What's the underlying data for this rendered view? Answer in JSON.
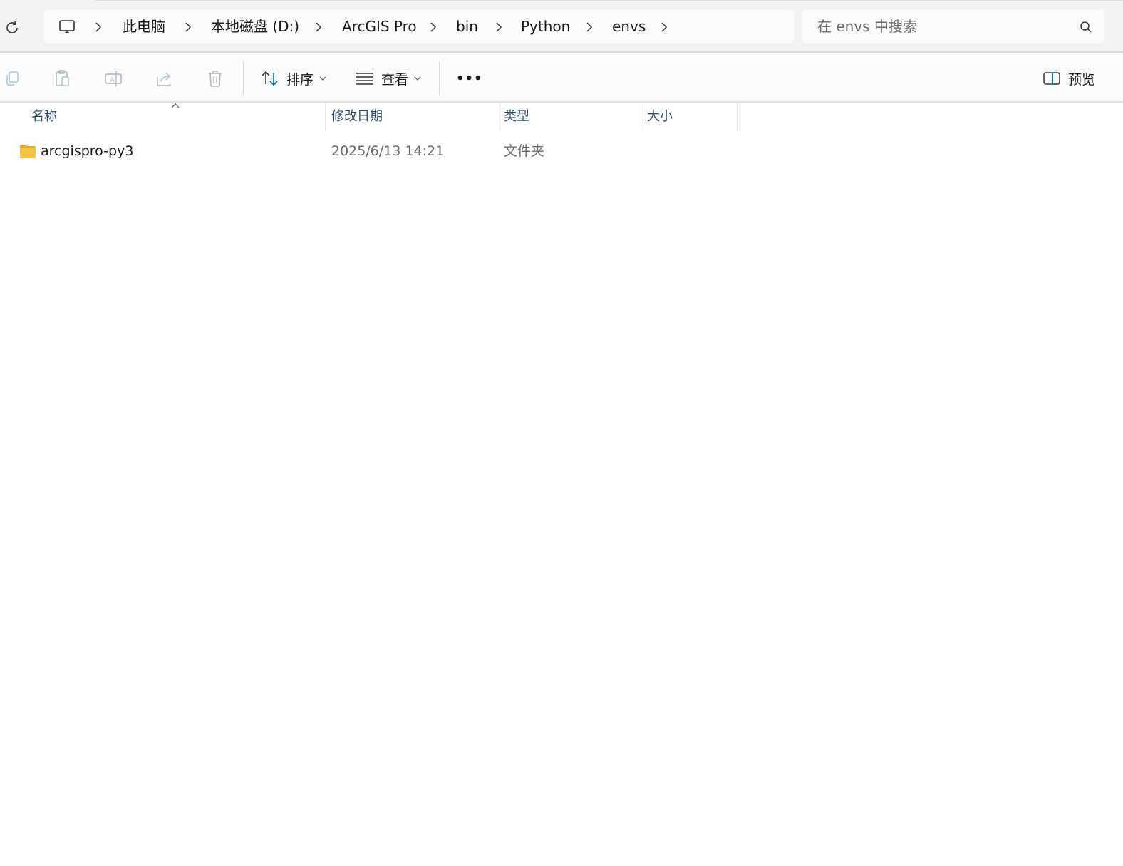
{
  "address_bar": {
    "breadcrumbs": [
      {
        "icon": "computer-icon"
      },
      {
        "label": "此电脑"
      },
      {
        "label": "本地磁盘 (D:)"
      },
      {
        "label": "ArcGIS Pro"
      },
      {
        "label": "bin"
      },
      {
        "label": "Python"
      },
      {
        "label": "envs"
      }
    ],
    "crumb_1": "此电脑",
    "crumb_2": "本地磁盘 (D:)",
    "crumb_3": "ArcGIS Pro",
    "crumb_4": "bin",
    "crumb_5": "Python",
    "crumb_6": "envs"
  },
  "search": {
    "placeholder": "在 envs 中搜索"
  },
  "toolbar": {
    "icons": [
      "copy-icon",
      "paste-icon",
      "rename-icon",
      "share-icon",
      "delete-icon"
    ],
    "sort_label": "排序",
    "view_label": "查看",
    "more_label": "•••",
    "preview_label": "预览"
  },
  "columns": {
    "name": "名称",
    "modified": "修改日期",
    "type": "类型",
    "size": "大小"
  },
  "files": [
    {
      "name": "arcgispro-py3",
      "modified": "2025/6/13 14:21",
      "type": "文件夹",
      "size": ""
    }
  ],
  "colors": {
    "accent": "#0067c0",
    "header_text": "#2e4a73",
    "folder": "#f6c344"
  }
}
